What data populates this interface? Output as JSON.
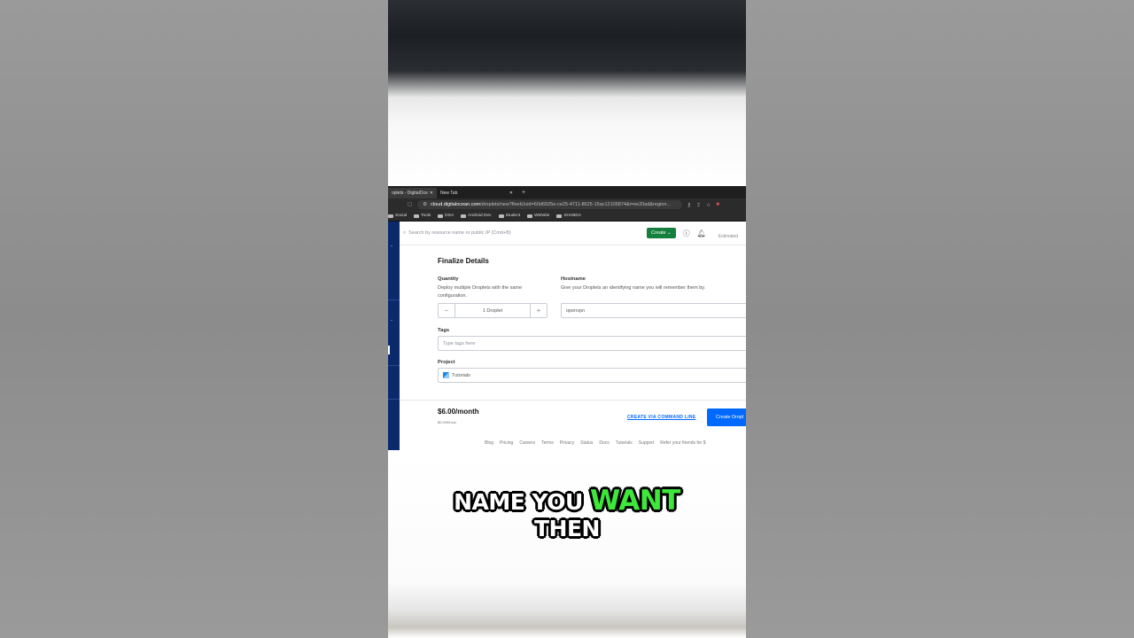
{
  "browser": {
    "tabs": [
      {
        "label": "oplets - DigitalOce",
        "active": true
      },
      {
        "label": "New Tab",
        "active": false
      }
    ],
    "url_host": "cloud.digitalocean.com",
    "url_path": "/droplets/new?fleetUuid=60d6925e-ce25-4711-8625-15ac12105874&i=ee20ad&region...",
    "bookmarks": [
      "Social",
      "Tools",
      "DSA",
      "Android Dev",
      "Student",
      "Website",
      "SHABDA"
    ]
  },
  "topnav": {
    "search_placeholder": "Search by resource name or public IP (Cmd+B)",
    "create_label": "Create",
    "estimated_label": "Estimated"
  },
  "form": {
    "title": "Finalize Details",
    "quantity_label": "Quantity",
    "quantity_help": "Deploy multiple Droplets with the same configuration.",
    "quantity_value": "1  Droplet",
    "hostname_label": "Hostname",
    "hostname_help": "Give your Droplets an identifying name you will remember them by.",
    "hostname_value": "openvpn",
    "tags_label": "Tags",
    "tags_placeholder": "Type tags here",
    "project_label": "Project",
    "project_value": "Tutorials"
  },
  "footer": {
    "price": "$6.00/month",
    "hourly": "$0.009/hour",
    "cli_link": "CREATE VIA COMMAND LINE",
    "create_button": "Create Dropl",
    "links": [
      "Blog",
      "Pricing",
      "Careers",
      "Terms",
      "Privacy",
      "Status",
      "Docs",
      "Tutorials",
      "Support",
      "Refer your friends for $"
    ]
  },
  "caption": {
    "line1_a": "NAME YOU ",
    "line1_highlight": "WANT",
    "line2": "THEN"
  },
  "colors": {
    "sidebar": "#0a2a6b",
    "create_green": "#15803d",
    "primary_blue": "#0069ff",
    "caption_highlight": "#3ee73a"
  }
}
